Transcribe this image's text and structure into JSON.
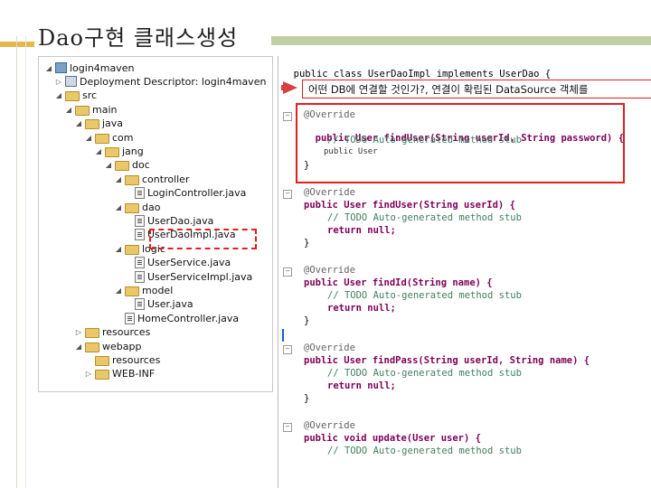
{
  "slide": {
    "title": "Dao구현 클래스생성"
  },
  "tree": {
    "items": [
      {
        "label": "login4maven",
        "twisty": "◢",
        "icon": "project-icon",
        "level": 0
      },
      {
        "label": "Deployment Descriptor: login4maven",
        "twisty": "▷",
        "icon": "descriptor-icon",
        "level": 1
      },
      {
        "label": "src",
        "twisty": "◢",
        "icon": "folder-icon",
        "level": 1
      },
      {
        "label": "main",
        "twisty": "◢",
        "icon": "folder-icon",
        "level": 2
      },
      {
        "label": "java",
        "twisty": "◢",
        "icon": "folder-icon",
        "level": 3
      },
      {
        "label": "com",
        "twisty": "◢",
        "icon": "folder-icon",
        "level": 4
      },
      {
        "label": "jang",
        "twisty": "◢",
        "icon": "folder-icon",
        "level": 5
      },
      {
        "label": "doc",
        "twisty": "◢",
        "icon": "folder-icon",
        "level": 6
      },
      {
        "label": "controller",
        "twisty": "◢",
        "icon": "folder-icon",
        "level": 7
      },
      {
        "label": "LoginController.java",
        "twisty": "",
        "icon": "file-icon",
        "level": 8
      },
      {
        "label": "dao",
        "twisty": "◢",
        "icon": "folder-icon",
        "level": 7
      },
      {
        "label": "UserDao.java",
        "twisty": "",
        "icon": "file-icon",
        "level": 8
      },
      {
        "label": "UserDaoImpl.java",
        "twisty": "",
        "icon": "file-icon",
        "level": 8
      },
      {
        "label": "logic",
        "twisty": "◢",
        "icon": "folder-icon",
        "level": 7
      },
      {
        "label": "UserService.java",
        "twisty": "",
        "icon": "file-icon",
        "level": 8
      },
      {
        "label": "UserServiceImpl.java",
        "twisty": "",
        "icon": "file-icon",
        "level": 8
      },
      {
        "label": "model",
        "twisty": "◢",
        "icon": "folder-icon",
        "level": 7
      },
      {
        "label": "User.java",
        "twisty": "",
        "icon": "file-icon",
        "level": 8
      },
      {
        "label": "HomeController.java",
        "twisty": "",
        "icon": "file-icon",
        "level": 7
      },
      {
        "label": "resources",
        "twisty": "▷",
        "icon": "folder-icon",
        "level": 3
      },
      {
        "label": "webapp",
        "twisty": "◢",
        "icon": "folder-icon",
        "level": 3
      },
      {
        "label": "resources",
        "twisty": "",
        "icon": "folder-icon",
        "level": 4
      },
      {
        "label": "WEB-INF",
        "twisty": "▷",
        "icon": "folder-icon",
        "level": 4
      }
    ]
  },
  "callout": {
    "text": "어떤 DB에 연결할 것인가?, 연결이 확립된 DataSource 객체를"
  },
  "code": {
    "class_decl": "public class UserDaoImpl implements UserDao {",
    "override": "@Override",
    "m1_sig": "public User findUser(String userId, String password) {",
    "todo": "// TODO Auto-generated method stub",
    "m1_popup": "public User",
    "close": "}",
    "m2_sig": "public User findUser(String userId) {",
    "ret_null": "return null;",
    "m3_sig": "public User findId(String name) {",
    "m4_sig": "public User findPass(String userId, String name) {",
    "m5_sig": "public void update(User user) {"
  },
  "colors": {
    "keyword": "#7f0055",
    "comment": "#3f7f5f",
    "highlight": "#e02020"
  }
}
